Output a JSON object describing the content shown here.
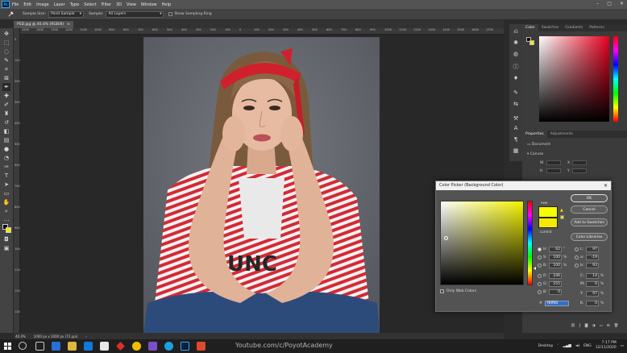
{
  "app": {
    "logo_text": "Ps",
    "menu": [
      "File",
      "Edit",
      "Image",
      "Layer",
      "Type",
      "Select",
      "Filter",
      "3D",
      "View",
      "Window",
      "Help"
    ],
    "window_controls": [
      "–",
      "▢",
      "✕"
    ]
  },
  "options_bar": {
    "sample_size_label": "Sample Size:",
    "sample_size_value": "Point Sample",
    "sample_label": "Sample:",
    "sample_value": "All Layers",
    "show_ring_label": "Show Sampling Ring"
  },
  "document": {
    "tab_label": "PSD.jpg @ 40.4% (RGB/8)",
    "tab_close": "×",
    "ruler_top_ticks": [
      "1500",
      "1400",
      "1300",
      "1200",
      "1100",
      "1000",
      "900",
      "800",
      "700",
      "600",
      "500",
      "400",
      "300",
      "200",
      "100",
      "0",
      "100",
      "200",
      "300",
      "400",
      "500",
      "600",
      "700",
      "800",
      "900",
      "1000",
      "1100",
      "1200",
      "1300",
      "1400",
      "1500",
      "1600",
      "1700"
    ],
    "ruler_left_ticks": [
      "0",
      "100",
      "200",
      "300",
      "400",
      "500",
      "600",
      "700",
      "800",
      "900",
      "1000",
      "1100",
      "1200",
      "1300"
    ]
  },
  "status_bar": {
    "zoom": "40.4%",
    "doc_size": "1000 px x 2000 px (72 ppi)",
    "arrow": "›"
  },
  "panels": {
    "color_tabs": [
      "Color",
      "Swatches",
      "Gradients",
      "Patterns"
    ],
    "properties_tabs": [
      "Properties",
      "Adjustments"
    ],
    "document_label": "Document",
    "canvas_label": "Canvas",
    "canvas_field_w": "W",
    "canvas_field_h": "H",
    "canvas_field_x": "X",
    "canvas_field_y": "Y"
  },
  "color_picker": {
    "title": "Color Picker (Background Color)",
    "close": "✕",
    "new_label": "new",
    "current_label": "current",
    "buttons": {
      "ok": "OK",
      "cancel": "Cancel",
      "add_to_swatches": "Add to Swatches",
      "color_libraries": "Color Libraries"
    },
    "only_web_colors": "Only Web Colors",
    "hsb": {
      "h_label": "H:",
      "h_value": "62",
      "h_unit": "°",
      "s_label": "S:",
      "s_value": "100",
      "s_unit": "%",
      "b_label": "B:",
      "b_value": "100",
      "b_unit": "%"
    },
    "rgb": {
      "r_label": "R:",
      "r_value": "246",
      "g_label": "G:",
      "g_value": "255",
      "b_label": "B:",
      "b_value": "0"
    },
    "lab": {
      "l_label": "L:",
      "l_value": "97",
      "a_label": "a:",
      "a_value": "-19",
      "b_label": "b:",
      "b_value": "93"
    },
    "cmyk": {
      "c_label": "C:",
      "c_value": "14",
      "c_unit": "%",
      "m_label": "M:",
      "m_value": "0",
      "m_unit": "%",
      "y_label": "Y:",
      "y_value": "97",
      "y_unit": "%",
      "k_label": "K:",
      "k_value": "0",
      "k_unit": "%"
    },
    "hex_label": "#",
    "hex_value": "f6ff00",
    "colors": {
      "new": "#f6ff00",
      "current": "#f4ea00"
    }
  },
  "taskbar": {
    "watermark": "Youtube.com/c/PoyotAcademy",
    "desktop_label": "Desktop",
    "language": "ENG",
    "time": "7:17 PM",
    "date": "12/11/2020"
  }
}
